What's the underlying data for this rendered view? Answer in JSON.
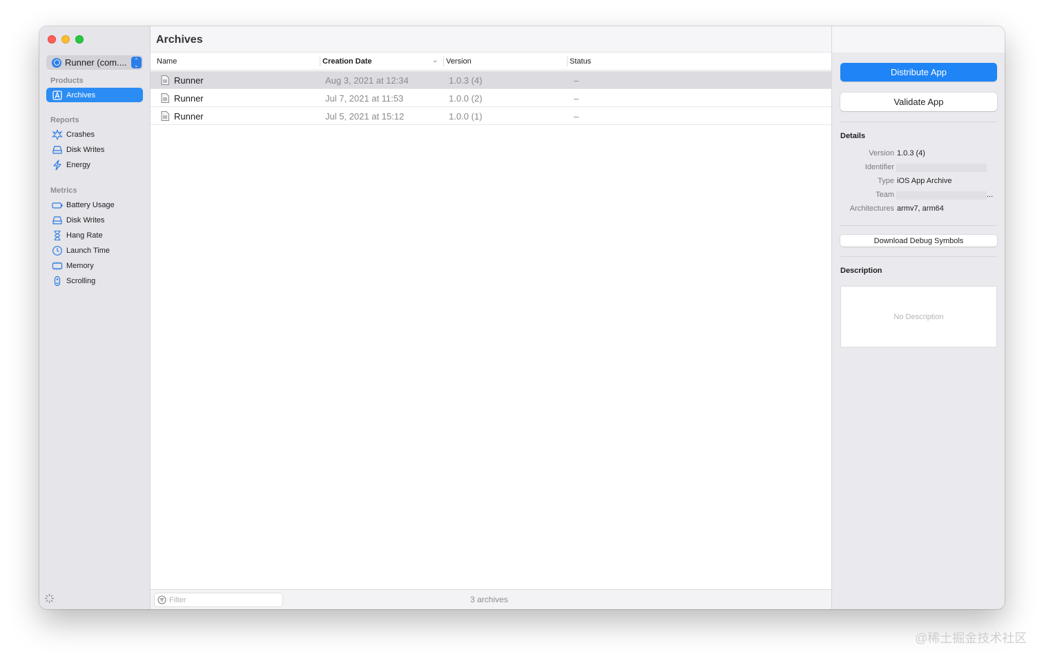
{
  "window": {
    "title": "Archives"
  },
  "sidebar": {
    "scheme": {
      "label": "Runner (com....",
      "stepper": [
        "⌃",
        "⌄"
      ]
    },
    "sections": [
      {
        "title": "Products",
        "items": [
          {
            "label": "Archives",
            "icon": "archive-app-icon",
            "selected": true
          }
        ]
      },
      {
        "title": "Reports",
        "items": [
          {
            "label": "Crashes",
            "icon": "crash-icon"
          },
          {
            "label": "Disk Writes",
            "icon": "disk-icon"
          },
          {
            "label": "Energy",
            "icon": "energy-bolt-icon"
          }
        ]
      },
      {
        "title": "Metrics",
        "items": [
          {
            "label": "Battery Usage",
            "icon": "battery-icon"
          },
          {
            "label": "Disk Writes",
            "icon": "disk-icon"
          },
          {
            "label": "Hang Rate",
            "icon": "hourglass-icon"
          },
          {
            "label": "Launch Time",
            "icon": "clock-icon"
          },
          {
            "label": "Memory",
            "icon": "memory-chip-icon"
          },
          {
            "label": "Scrolling",
            "icon": "scroll-icon"
          }
        ]
      }
    ]
  },
  "table": {
    "columns": [
      "Name",
      "Creation Date",
      "Version",
      "Status"
    ],
    "sort_column": "Creation Date",
    "sort_indicator": "⌄",
    "rows": [
      {
        "name": "Runner",
        "date": "Aug 3, 2021 at 12:34",
        "version": "1.0.3 (4)",
        "status": "–",
        "selected": true
      },
      {
        "name": "Runner",
        "date": "Jul 7, 2021 at 11:53",
        "version": "1.0.0 (2)",
        "status": "–"
      },
      {
        "name": "Runner",
        "date": "Jul 5, 2021 at 15:12",
        "version": "1.0.0 (1)",
        "status": "–"
      }
    ]
  },
  "footer": {
    "filter_placeholder": "Filter",
    "count": "3 archives"
  },
  "inspector": {
    "distribute_label": "Distribute App",
    "validate_label": "Validate App",
    "details_title": "Details",
    "details": {
      "version_key": "Version",
      "version_value": "1.0.3 (4)",
      "identifier_key": "Identifier",
      "type_key": "Type",
      "type_value": "iOS App Archive",
      "team_key": "Team",
      "team_ellipsis": "...",
      "arch_key": "Architectures",
      "arch_value": "armv7, arm64"
    },
    "download_symbols_label": "Download Debug Symbols",
    "description_title": "Description",
    "description_placeholder": "No Description"
  },
  "watermark": "@稀土掘金技术社区",
  "colors": {
    "accent": "#1f84f5",
    "selection": "#2b8cf3",
    "sidebar_bg": "#e6e5e9",
    "inspector_bg": "#eae9ed"
  }
}
